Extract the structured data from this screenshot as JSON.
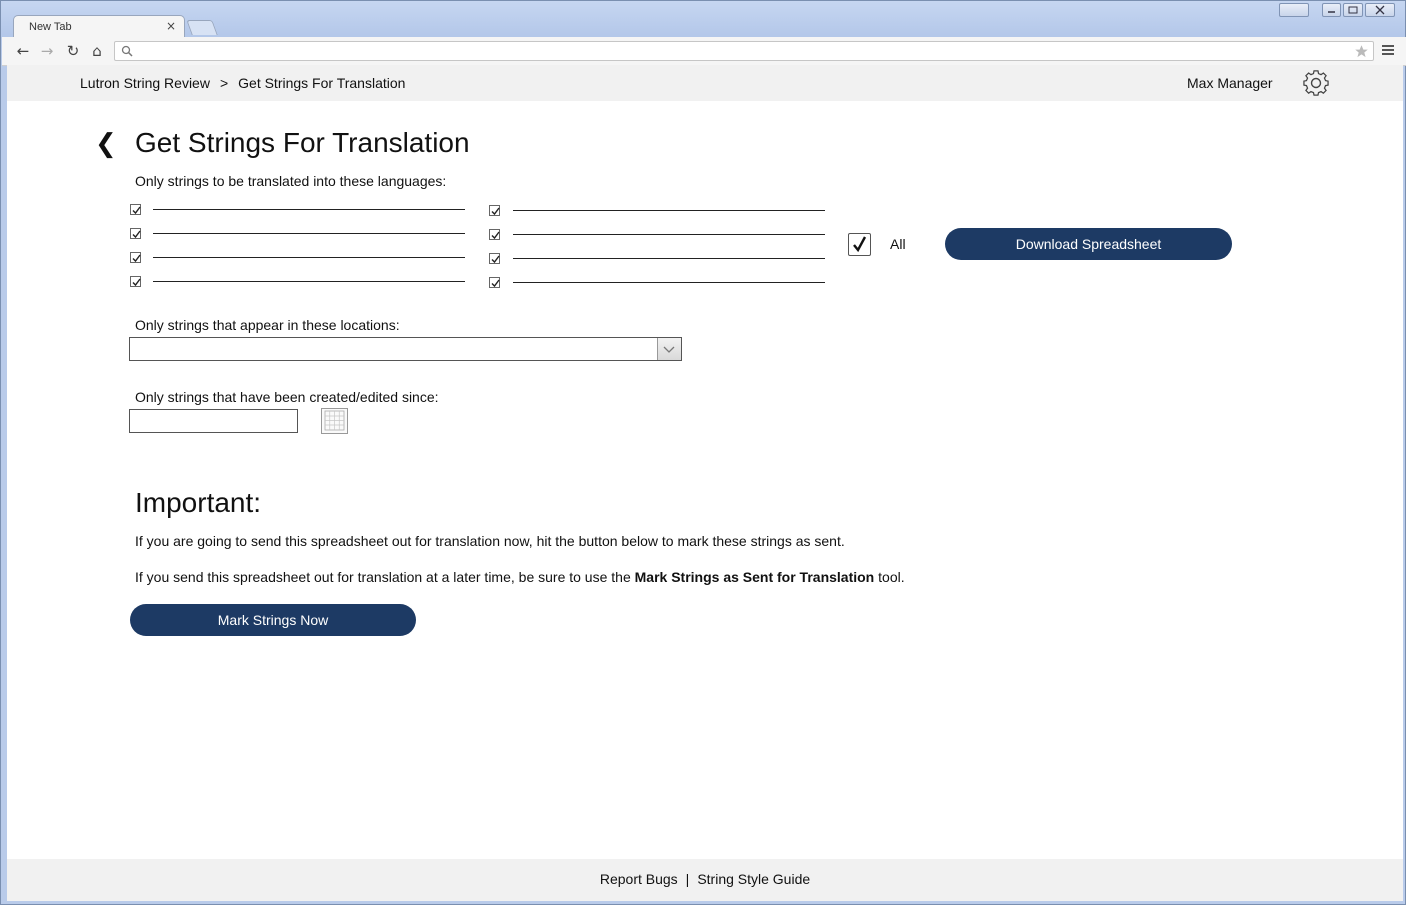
{
  "browser": {
    "tab_title": "New Tab",
    "tab_close": "×",
    "profile_label": "",
    "nav": {
      "back": "←",
      "forward": "→",
      "reload": "↻",
      "home": "⌂"
    },
    "search_icon": "search-icon",
    "star_icon": "star-icon",
    "menu_icon": "menu-icon"
  },
  "header": {
    "breadcrumb_root": "Lutron String Review",
    "breadcrumb_sep": ">",
    "breadcrumb_current": "Get Strings For Translation",
    "user_name": "Max Manager",
    "settings_icon": "gear-icon"
  },
  "page": {
    "back_glyph": "❮",
    "title": "Get Strings For Translation"
  },
  "languages": {
    "label": "Only strings to be translated into these languages:",
    "left": [
      {
        "name": "",
        "checked": true
      },
      {
        "name": "",
        "checked": true
      },
      {
        "name": "",
        "checked": true
      },
      {
        "name": "",
        "checked": true
      }
    ],
    "right": [
      {
        "name": "",
        "checked": true
      },
      {
        "name": "",
        "checked": true
      },
      {
        "name": "",
        "checked": true
      },
      {
        "name": "",
        "checked": true
      }
    ],
    "all_label": "All",
    "all_checked": true
  },
  "download_button": "Download Spreadsheet",
  "locations": {
    "label": "Only strings that appear in these locations:",
    "selected": ""
  },
  "since": {
    "label": "Only strings that have been created/edited since:",
    "value": "",
    "calendar_icon": "calendar-icon"
  },
  "important": {
    "title": "Important:",
    "line1": "If you are going to send this spreadsheet out for translation now, hit the button below to mark these strings as sent.",
    "line2_before": "If you send this spreadsheet out for translation at a later time, be sure to use the ",
    "line2_bold": "Mark Strings as Sent for Translation",
    "line2_after": " tool.",
    "button": "Mark Strings Now"
  },
  "footer": {
    "report_bugs": "Report Bugs",
    "separator": "|",
    "style_guide": "String Style Guide"
  },
  "colors": {
    "primary_button": "#1d3a64",
    "header_bg": "#f1f1f1"
  }
}
